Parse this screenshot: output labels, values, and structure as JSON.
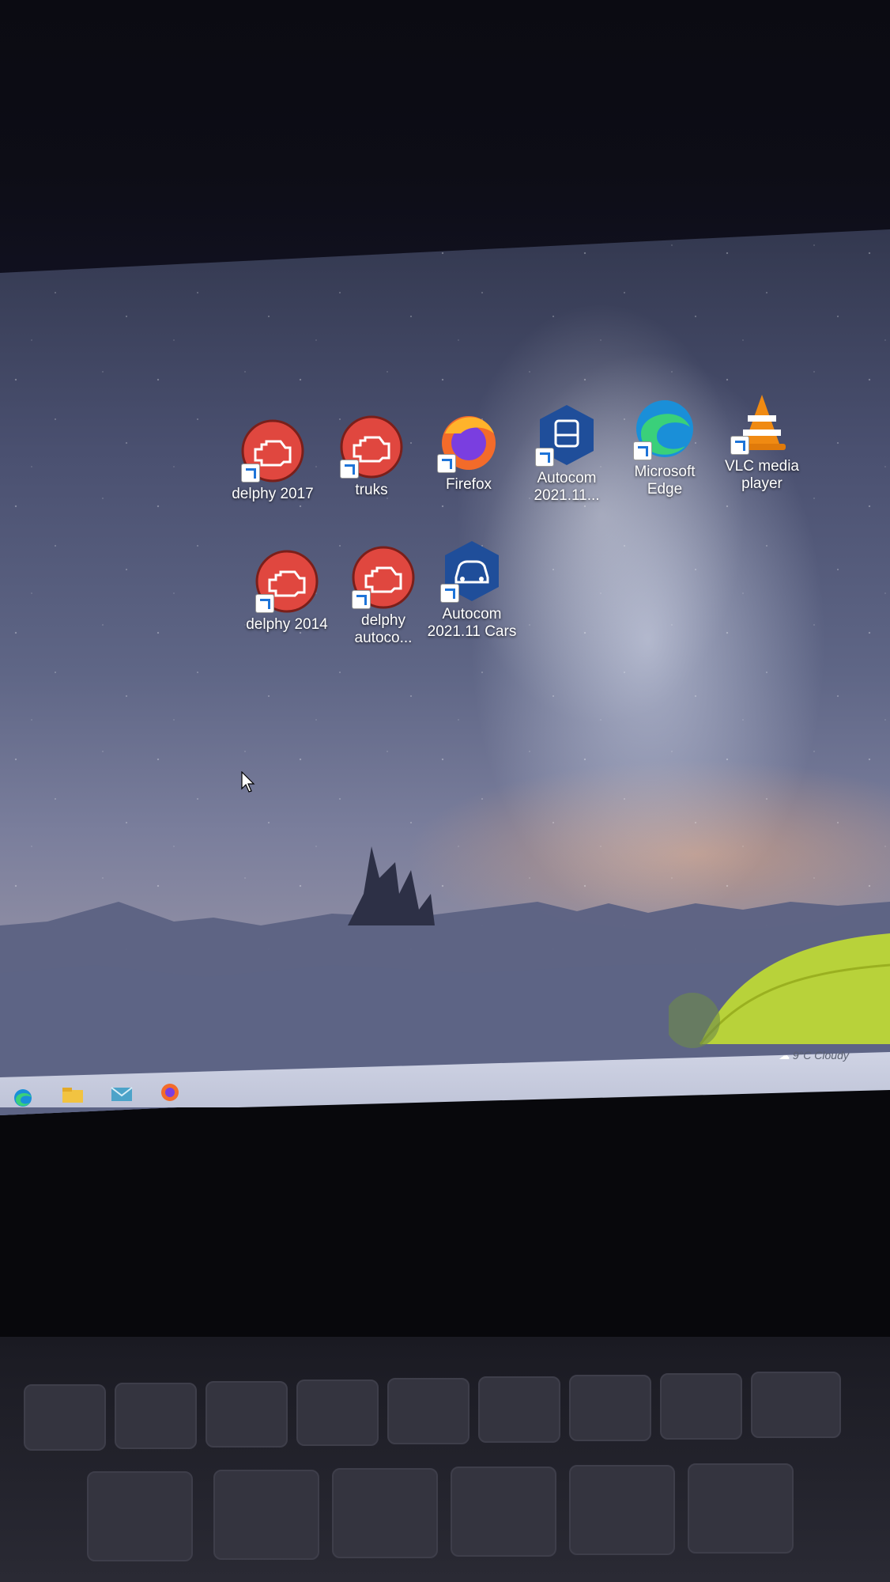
{
  "desktop": {
    "icons": [
      {
        "label": "delphy 2017",
        "icon": "delphi-icon"
      },
      {
        "label": "truks",
        "icon": "delphi-icon"
      },
      {
        "label": "Firefox",
        "icon": "firefox-icon"
      },
      {
        "label": "Autocom\n2021.11...",
        "icon": "autocom-truck-icon"
      },
      {
        "label": "Microsoft\nEdge",
        "icon": "edge-icon"
      },
      {
        "label": "VLC media\nplayer",
        "icon": "vlc-icon"
      },
      {
        "label": "delphy 2014",
        "icon": "delphi-icon"
      },
      {
        "label": "delphy\nautoco...",
        "icon": "delphi-icon"
      },
      {
        "label": "Autocom\n2021.11 Cars",
        "icon": "autocom-car-icon"
      }
    ]
  },
  "taskbar": {
    "weather": "9°C  Cloudy",
    "apps": [
      "edge-icon",
      "file-explorer-icon",
      "mail-icon",
      "firefox-icon"
    ]
  },
  "colors": {
    "delphi_red": "#e0473f",
    "autocom_blue": "#1f4e9a",
    "vlc_orange": "#f08a12"
  }
}
